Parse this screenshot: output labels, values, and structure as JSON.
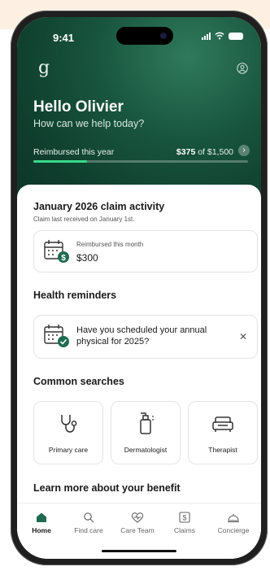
{
  "status": {
    "time": "9:41"
  },
  "header": {
    "brand": "g",
    "greeting": "Hello Olivier",
    "subtitle": "How can we help today?"
  },
  "reimbursement": {
    "label": "Reimbursed this year",
    "amount": "$375",
    "of_text": "of $1,500",
    "progress_fraction": 0.25,
    "chevron": "›"
  },
  "claim_activity": {
    "title": "January 2026 claim activity",
    "subtitle": "Claim last received on January 1st.",
    "card_label": "Reimbursed this month",
    "card_value": "$300",
    "icon": "calendar-dollar-icon"
  },
  "health_reminders": {
    "title": "Health reminders",
    "text": "Have you scheduled your annual physical for 2025?",
    "close": "✕",
    "icon": "calendar-check-icon"
  },
  "common_searches": {
    "title": "Common searches",
    "items": [
      {
        "label": "Primary care",
        "icon": "stethoscope-icon"
      },
      {
        "label": "Dermatologist",
        "icon": "lotion-bottle-icon"
      },
      {
        "label": "Therapist",
        "icon": "couch-icon"
      }
    ]
  },
  "learn_more": {
    "title": "Learn more about your benefit"
  },
  "tabs": [
    {
      "label": "Home",
      "icon": "home-icon",
      "active": true
    },
    {
      "label": "Find care",
      "icon": "search-icon"
    },
    {
      "label": "Care Team",
      "icon": "heart-pulse-icon"
    },
    {
      "label": "Claims",
      "icon": "dollar-document-icon"
    },
    {
      "label": "Concierge",
      "icon": "bell-icon"
    }
  ],
  "colors": {
    "hero_dark": "#0f3d2d",
    "accent_green": "#39d98a",
    "badge_teal": "#1f6b4f"
  }
}
